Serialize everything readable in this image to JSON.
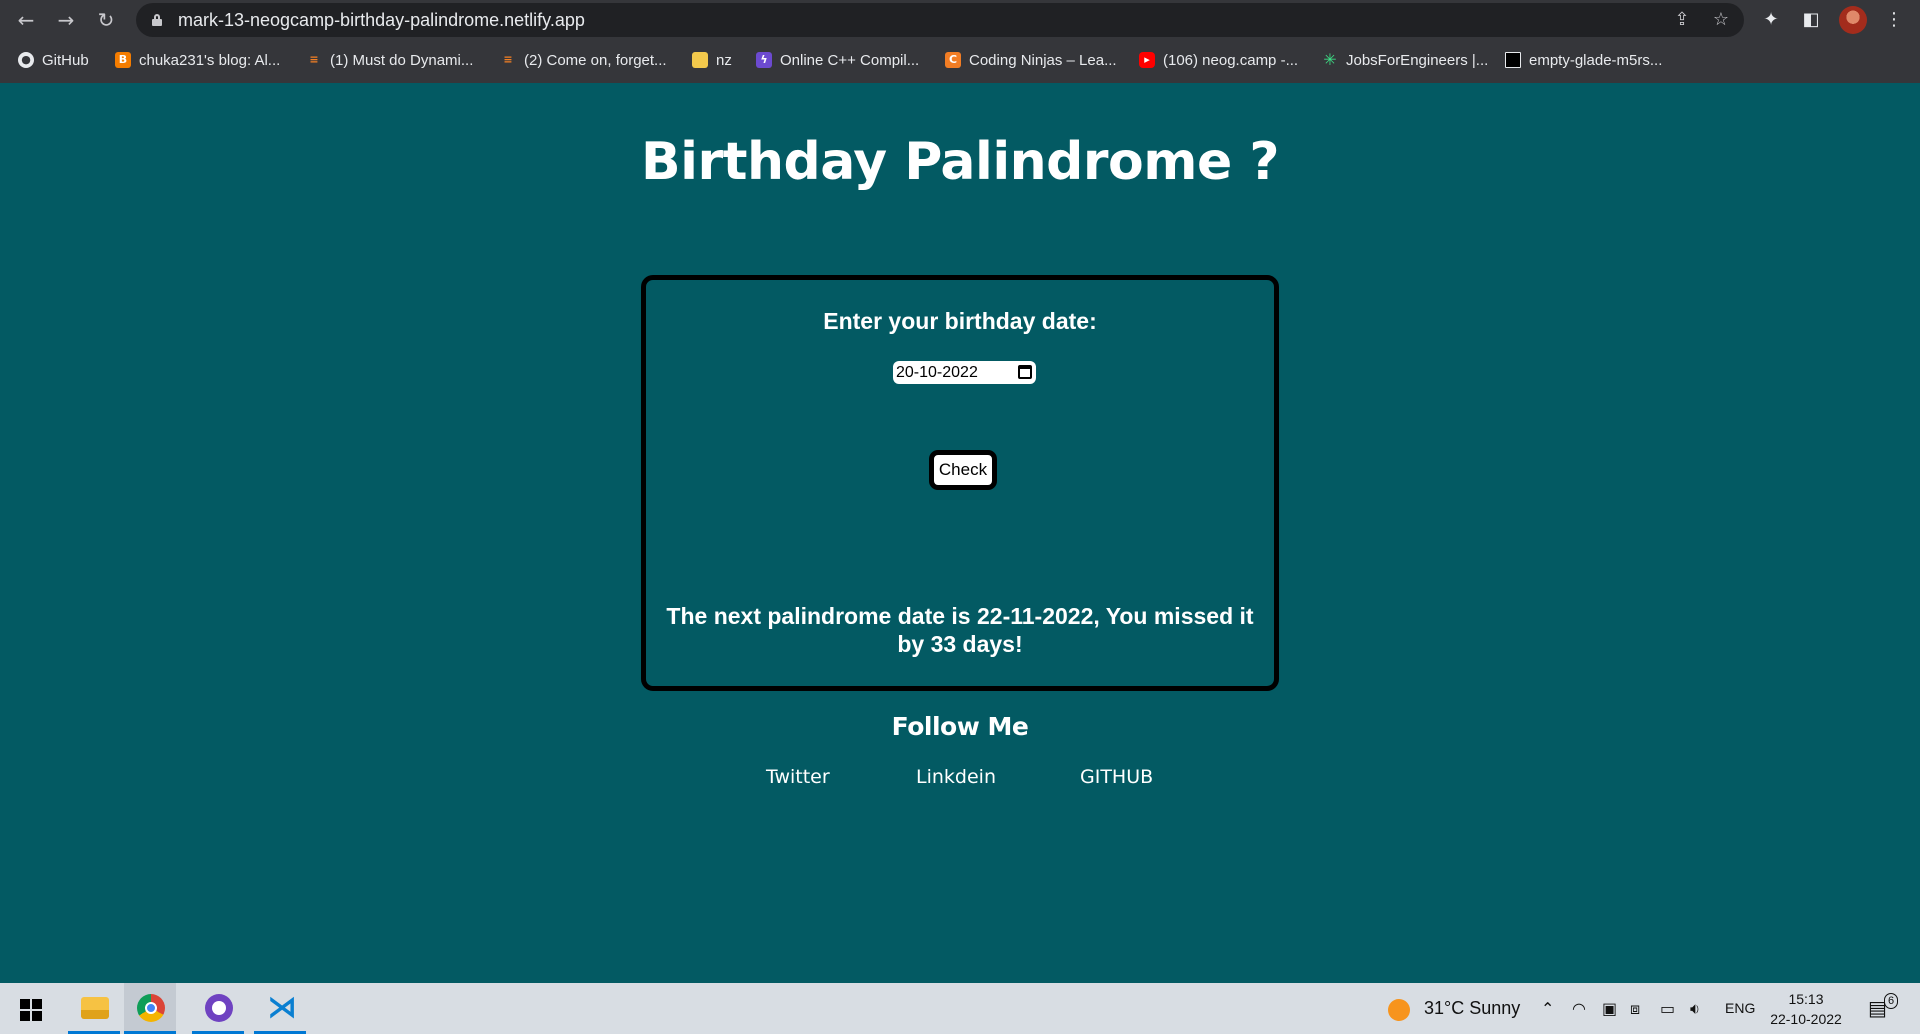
{
  "browser": {
    "url": "mark-13-neogcamp-birthday-palindrome.netlify.app",
    "bookmarks": [
      {
        "label": "GitHub",
        "icon": "github-icon",
        "color": "#ffffff"
      },
      {
        "label": "chuka231's blog: Al...",
        "icon": "blogger-icon",
        "color": "#f57d00"
      },
      {
        "label": "(1) Must do Dynami...",
        "icon": "stackoverflow-icon",
        "color": "#f48024"
      },
      {
        "label": "(2) Come on, forget...",
        "icon": "stackoverflow-icon",
        "color": "#f48024"
      },
      {
        "label": "nz",
        "icon": "folder-icon",
        "color": "#f2c94c"
      },
      {
        "label": "Online C++ Compil...",
        "icon": "replit-bolt-icon",
        "color": "#6c4ad0"
      },
      {
        "label": "Coding Ninjas – Lea...",
        "icon": "coding-ninjas-icon",
        "color": "#f27d24"
      },
      {
        "label": "(106) neog.camp -...",
        "icon": "youtube-icon",
        "color": "#ff0000"
      },
      {
        "label": "JobsForEngineers |...",
        "icon": "asterisk-icon",
        "color": "#3ddc84"
      },
      {
        "label": "empty-glade-m5rs...",
        "icon": "square-icon",
        "color": "#000000"
      }
    ]
  },
  "page": {
    "title": "Birthday Palindrome ?",
    "form_label": "Enter your birthday date:",
    "date_value": "20-10-2022",
    "check_label": "Check",
    "result": "The next palindrome date is 22-11-2022, You missed it by 33 days!",
    "follow_heading": "Follow Me",
    "links": [
      "Twitter",
      "Linkdein",
      "GITHUB"
    ]
  },
  "colors": {
    "background": "#035a63",
    "card_border": "#000000",
    "text": "#ffffff"
  },
  "taskbar": {
    "apps": [
      "file-explorer-icon",
      "chrome-icon",
      "github-desktop-icon",
      "vscode-icon"
    ],
    "weather": "31°C  Sunny",
    "language": "ENG",
    "time": "15:13",
    "date": "22-10-2022",
    "notifications": "6"
  }
}
